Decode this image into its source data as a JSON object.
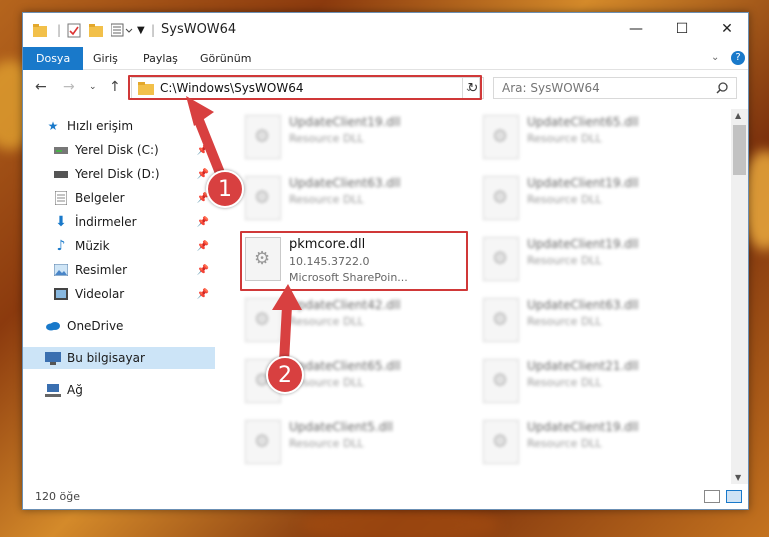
{
  "window": {
    "title": "SysWOW64",
    "controls": {
      "minimize": "—",
      "maximize": "☐",
      "close": "✕"
    }
  },
  "ribbon": {
    "tabs": [
      "Dosya",
      "Giriş",
      "Paylaş",
      "Görünüm"
    ],
    "help": "?"
  },
  "address": {
    "path": "C:\\Windows\\SysWOW64",
    "search_placeholder": "Ara: SysWOW64"
  },
  "sidebar": {
    "items": [
      {
        "label": "Hızlı erişim",
        "icon": "star-icon"
      },
      {
        "label": "Yerel Disk (C:)",
        "icon": "drive-icon"
      },
      {
        "label": "Yerel Disk (D:)",
        "icon": "drive-icon"
      },
      {
        "label": "Belgeler",
        "icon": "documents-icon"
      },
      {
        "label": "İndirmeler",
        "icon": "download-icon"
      },
      {
        "label": "Müzik",
        "icon": "music-icon"
      },
      {
        "label": "Resimler",
        "icon": "pictures-icon"
      },
      {
        "label": "Videolar",
        "icon": "videos-icon"
      },
      {
        "label": "OneDrive",
        "icon": "cloud-icon"
      },
      {
        "label": "Bu bilgisayar",
        "icon": "computer-icon"
      },
      {
        "label": "Ağ",
        "icon": "network-icon"
      }
    ]
  },
  "files": {
    "left": [
      {
        "name": "UpdateClient19.dll",
        "sub": "Resource DLL"
      },
      {
        "name": "UpdateClient63.dll",
        "sub": "Resource DLL"
      },
      {
        "name": "pkmcore.dll",
        "sub": "10.145.3722.0",
        "sub2": "Microsoft SharePoin..."
      },
      {
        "name": "UpdateClient42.dll",
        "sub": "Resource DLL"
      },
      {
        "name": "UpdateClient65.dll",
        "sub": "Resource DLL"
      },
      {
        "name": "UpdateClient5.dll",
        "sub": "Resource DLL"
      }
    ],
    "right": [
      {
        "name": "UpdateClient65.dll",
        "sub": "Resource DLL"
      },
      {
        "name": "UpdateClient19.dll",
        "sub": "Resource DLL"
      },
      {
        "name": "UpdateClient19.dll",
        "sub": "Resource DLL"
      },
      {
        "name": "UpdateClient63.dll",
        "sub": "Resource DLL"
      },
      {
        "name": "UpdateClient21.dll",
        "sub": "Resource DLL"
      },
      {
        "name": "UpdateClient19.dll",
        "sub": "Resource DLL"
      }
    ]
  },
  "status": {
    "count": "120 öğe"
  },
  "callouts": {
    "one": "1",
    "two": "2"
  },
  "colors": {
    "accent": "#1979ca",
    "highlight": "#d03838"
  }
}
